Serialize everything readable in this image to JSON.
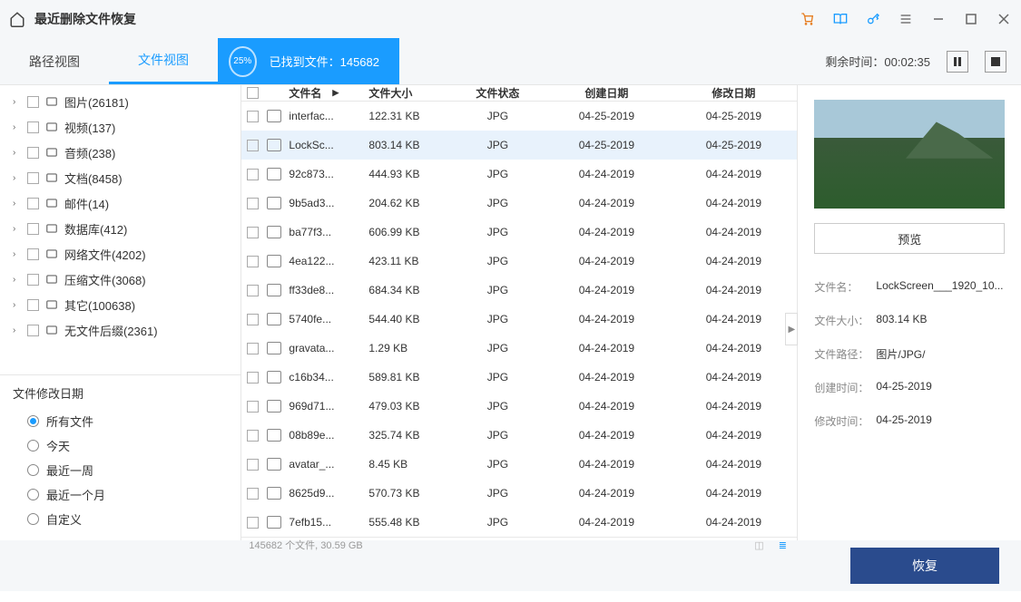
{
  "titlebar": {
    "title": "最近删除文件恢复"
  },
  "tabs": {
    "path": "路径视图",
    "file": "文件视图"
  },
  "progress": {
    "percent": "25%",
    "label": "已找到文件：",
    "count": "145682"
  },
  "remaining": {
    "label": "剩余时间：00:02:35"
  },
  "tree": [
    {
      "label": "图片(26181)"
    },
    {
      "label": "视频(137)"
    },
    {
      "label": "音频(238)"
    },
    {
      "label": "文档(8458)"
    },
    {
      "label": "邮件(14)"
    },
    {
      "label": "数据库(412)"
    },
    {
      "label": "网络文件(4202)"
    },
    {
      "label": "压缩文件(3068)"
    },
    {
      "label": "其它(100638)"
    },
    {
      "label": "无文件后缀(2361)"
    }
  ],
  "filter": {
    "title": "文件修改日期",
    "options": [
      "所有文件",
      "今天",
      "最近一周",
      "最近一个月",
      "自定义"
    ]
  },
  "th": {
    "name": "文件名",
    "size": "文件大小",
    "stat": "文件状态",
    "cdate": "创建日期",
    "mdate": "修改日期"
  },
  "rows": [
    {
      "n": "interfac...",
      "s": "122.31  KB",
      "st": "JPG",
      "cd": "04-25-2019",
      "md": "04-25-2019"
    },
    {
      "n": "LockSc...",
      "s": "803.14  KB",
      "st": "JPG",
      "cd": "04-25-2019",
      "md": "04-25-2019",
      "sel": true
    },
    {
      "n": "92c873...",
      "s": "444.93  KB",
      "st": "JPG",
      "cd": "04-24-2019",
      "md": "04-24-2019"
    },
    {
      "n": "9b5ad3...",
      "s": "204.62  KB",
      "st": "JPG",
      "cd": "04-24-2019",
      "md": "04-24-2019"
    },
    {
      "n": "ba77f3...",
      "s": "606.99  KB",
      "st": "JPG",
      "cd": "04-24-2019",
      "md": "04-24-2019"
    },
    {
      "n": "4ea122...",
      "s": "423.11  KB",
      "st": "JPG",
      "cd": "04-24-2019",
      "md": "04-24-2019"
    },
    {
      "n": "ff33de8...",
      "s": "684.34  KB",
      "st": "JPG",
      "cd": "04-24-2019",
      "md": "04-24-2019"
    },
    {
      "n": "5740fe...",
      "s": "544.40  KB",
      "st": "JPG",
      "cd": "04-24-2019",
      "md": "04-24-2019"
    },
    {
      "n": "gravata...",
      "s": "1.29  KB",
      "st": "JPG",
      "cd": "04-24-2019",
      "md": "04-24-2019"
    },
    {
      "n": "c16b34...",
      "s": "589.81  KB",
      "st": "JPG",
      "cd": "04-24-2019",
      "md": "04-24-2019"
    },
    {
      "n": "969d71...",
      "s": "479.03  KB",
      "st": "JPG",
      "cd": "04-24-2019",
      "md": "04-24-2019"
    },
    {
      "n": "08b89e...",
      "s": "325.74  KB",
      "st": "JPG",
      "cd": "04-24-2019",
      "md": "04-24-2019"
    },
    {
      "n": "avatar_...",
      "s": "8.45  KB",
      "st": "JPG",
      "cd": "04-24-2019",
      "md": "04-24-2019"
    },
    {
      "n": "8625d9...",
      "s": "570.73  KB",
      "st": "JPG",
      "cd": "04-24-2019",
      "md": "04-24-2019"
    },
    {
      "n": "7efb15...",
      "s": "555.48  KB",
      "st": "JPG",
      "cd": "04-24-2019",
      "md": "04-24-2019"
    }
  ],
  "status": {
    "text": "145682 个文件, 30.59  GB"
  },
  "preview": {
    "btn": "预览",
    "meta": [
      {
        "l": "文件名：",
        "v": "LockScreen___1920_10..."
      },
      {
        "l": "文件大小：",
        "v": "803.14  KB"
      },
      {
        "l": "文件路径：",
        "v": "图片/JPG/"
      },
      {
        "l": "创建时间：",
        "v": "04-25-2019"
      },
      {
        "l": "修改时间：",
        "v": "04-25-2019"
      }
    ]
  },
  "recover": "恢复"
}
